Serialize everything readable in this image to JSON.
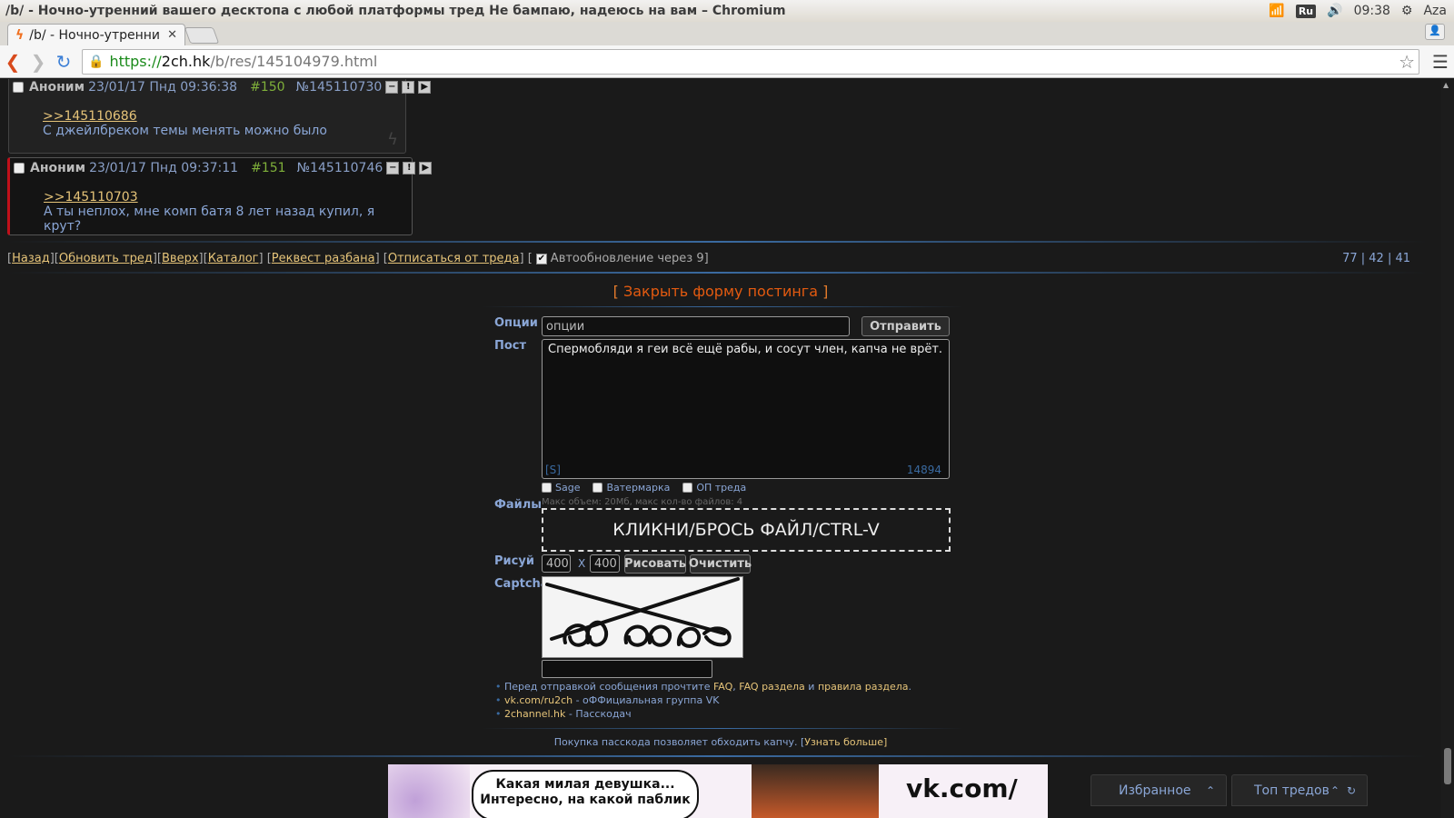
{
  "os": {
    "window_title": "/b/ - Ночно-утренний вашего десктопа с любой платформы тред Не бампаю, надеюсь на вам – Chromium",
    "lang": "Ru",
    "time": "09:38",
    "user": "Aza"
  },
  "browser": {
    "tab_title": "/b/ - Ночно-утренни",
    "url_scheme": "https://",
    "url_host": "2ch.hk",
    "url_path": "/b/res/145104979.html"
  },
  "posts": [
    {
      "name": "Аноним",
      "date": "23/01/17 Пнд 09:36:38",
      "num": "#150",
      "id": "№145110730",
      "reply": ">>145110686",
      "text": "С джейлбреком темы менять можно было"
    },
    {
      "name": "Аноним",
      "date": "23/01/17 Пнд 09:37:11",
      "num": "#151",
      "id": "№145110746",
      "reply": ">>145110703",
      "text": "А ты неплох, мне комп батя 8 лет назад купил, я крут?"
    }
  ],
  "nav": {
    "back": "Назад",
    "update": "Обновить тред",
    "up": "Вверх",
    "catalog": "Каталог",
    "request": "Реквест разбана",
    "unsubscribe": "Отписаться от треда",
    "autoupdate": "Автообновление через 9",
    "stats": "77 | 42 | 41"
  },
  "form": {
    "close": "Закрыть форму постинга",
    "label_options": "Опции",
    "options_value": "опции",
    "submit": "Отправить",
    "label_post": "Пост",
    "post_text": "Спермобляди я геи всё ещё рабы, и сосут член, капча не врёт.",
    "spoiler_tag": "[S]",
    "char_count": "14894",
    "sage": "Sage",
    "watermark": "Ватермарка",
    "op": "ОП треда",
    "label_files": "Файлы",
    "file_info": "Макс объем: 20Мб, макс кол-во файлов: 4",
    "dropzone": "КЛИКНИ/БРОСЬ ФАЙЛ/CTRL-V",
    "label_draw": "Рисуй",
    "draw_w": "400",
    "draw_x": "X",
    "draw_h": "400",
    "draw": "Рисовать",
    "clear": "Очистить",
    "label_captcha": "Captcha"
  },
  "links": {
    "l1_pre": "Перед отправкой сообщения прочтите ",
    "l1_faq": "FAQ",
    "l1_sep": ", ",
    "l1_faq2": "FAQ раздела",
    "l1_and": " и ",
    "l1_rules": "правила раздела",
    "l1_end": ".",
    "l2_link": "vk.com/ru2ch",
    "l2_text": " - оФФициальная группа VK",
    "l3_link": "2channel.hk",
    "l3_text": " - Пасскодач"
  },
  "passcode": {
    "text": "Покупка пасскода позволяет обходить капчу. [",
    "more": "Узнать больше",
    "end": "]"
  },
  "banner": {
    "line1": "Какая милая девушка...",
    "line2": "Интересно, на какой паблик",
    "vk": "vk.com/"
  },
  "bottom": {
    "favorites": "Избранное",
    "top": "Топ тредов"
  }
}
